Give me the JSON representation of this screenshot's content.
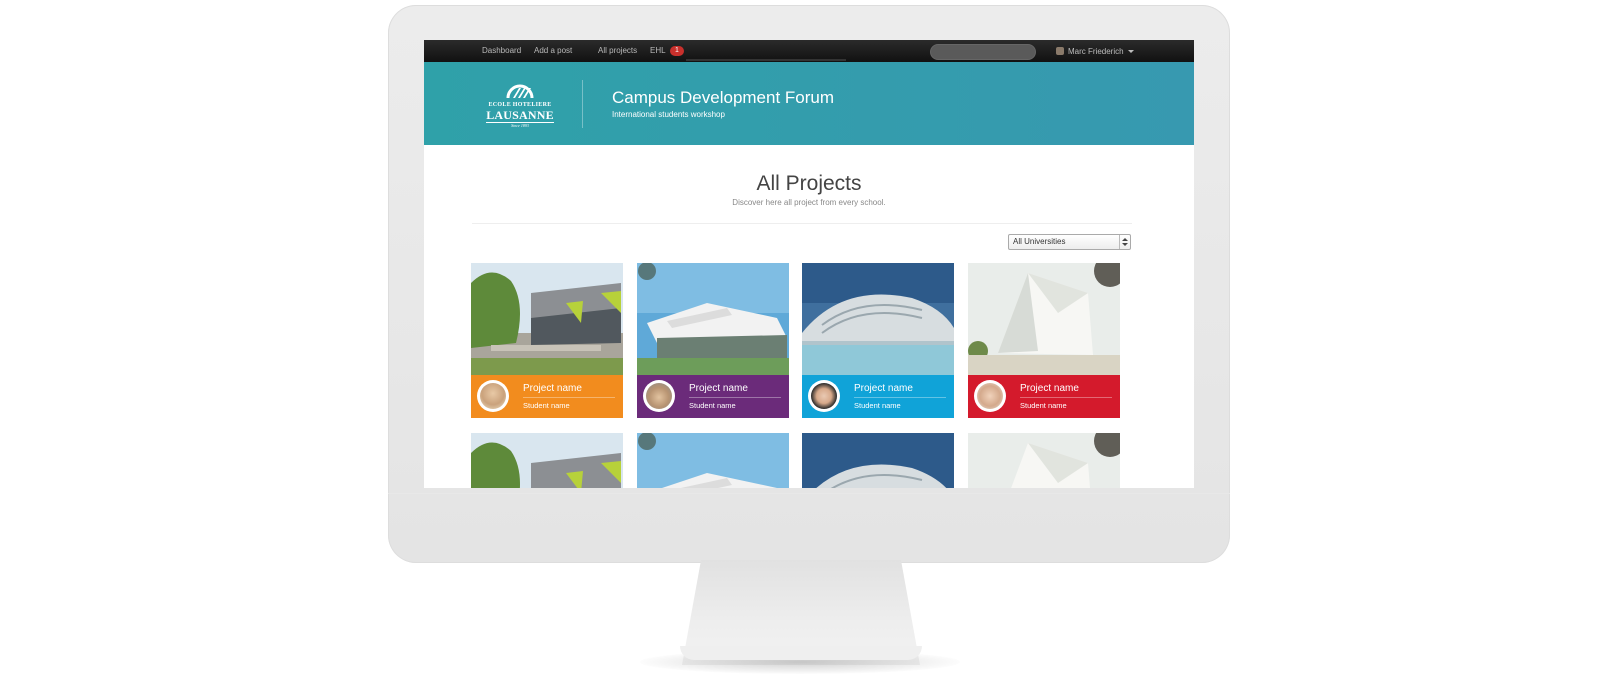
{
  "navbar": {
    "links": [
      "Dashboard",
      "Add a post",
      "All projects",
      "EHL"
    ],
    "badge_count": "1",
    "user_name": "Marc Friederich"
  },
  "brand": {
    "logo_line1": "ECOLE HOTELIERE",
    "logo_line2": "LAUSANNE",
    "logo_line3": "Since 1893",
    "title": "Campus Development Forum",
    "subtitle": "International students workshop"
  },
  "main": {
    "title": "All Projects",
    "subtitle": "Discover here all project from every school.",
    "filter_selected": "All Universities"
  },
  "projects": [
    {
      "project": "Project name",
      "student": "Student name",
      "color": "#f28c1e"
    },
    {
      "project": "Project name",
      "student": "Student name",
      "color": "#6b2b7a"
    },
    {
      "project": "Project name",
      "student": "Student name",
      "color": "#10a3d8"
    },
    {
      "project": "Project name",
      "student": "Student name",
      "color": "#d41a2c"
    }
  ],
  "colors": {
    "banner": "#3399ae",
    "navbar": "#1a1a1a",
    "badge": "#c9302c"
  }
}
